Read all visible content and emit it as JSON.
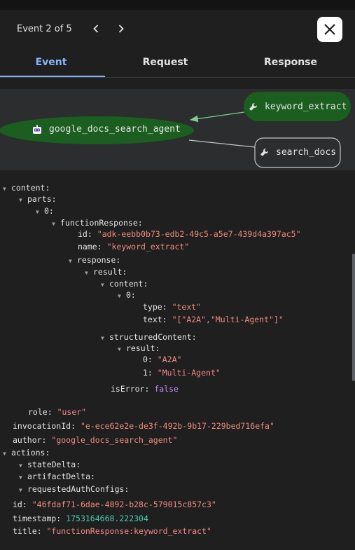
{
  "header": {
    "title": "Event 2 of 5"
  },
  "tabs": [
    {
      "label": "Event"
    },
    {
      "label": "Request"
    },
    {
      "label": "Response"
    }
  ],
  "graph": {
    "agent": "google_docs_search_agent",
    "tool1": "keyword_extract",
    "tool2": "search_docs",
    "colors": {
      "active_fill": "#1b5e20",
      "idle_fill": "#2b2d2e",
      "edge_active": "#81c995",
      "edge": "#c4c7c5"
    }
  },
  "tree": {
    "content_key": "content:",
    "parts_key": "parts:",
    "idx0_key": "0:",
    "fr_key": "functionResponse:",
    "id_key": "id:",
    "id_val": "\"adk-eebb0b73-edb2-49c5-a5e7-439d4a397ac5\"",
    "name_key": "name:",
    "name_val": "\"keyword_extract\"",
    "response_key": "response:",
    "result_key": "result:",
    "inner_content_key": "content:",
    "inner_idx0_key": "0:",
    "type_key": "type:",
    "type_val": "\"text\"",
    "text_key": "text:",
    "text_val": "\"[\"A2A\",\"Multi-Agent\"]\"",
    "structured_key": "structuredContent:",
    "sresult_key": "result:",
    "r0_key": "0:",
    "r0_val": "\"A2A\"",
    "r1_key": "1:",
    "r1_val": "\"Multi-Agent\"",
    "iserror_key": "isError:",
    "iserror_val": "false",
    "role_key": "role:",
    "role_val": "\"user\"",
    "invocation_key": "invocationId:",
    "invocation_val": "\"e-ece62e2e-de3f-492b-9b17-229bed716efa\"",
    "author_key": "author:",
    "author_val": "\"google_docs_search_agent\"",
    "actions_key": "actions:",
    "statedelta_key": "stateDelta:",
    "artifactdelta_key": "artifactDelta:",
    "requestedauth_key": "requestedAuthConfigs:",
    "eid_key": "id:",
    "eid_val": "\"46fdaf71-6dae-4892-b28c-579015c857c3\"",
    "timestamp_key": "timestamp:",
    "timestamp_val": "1753164668.222304",
    "title_key": "title:",
    "title_val": "\"functionResponse:keyword_extract\""
  }
}
